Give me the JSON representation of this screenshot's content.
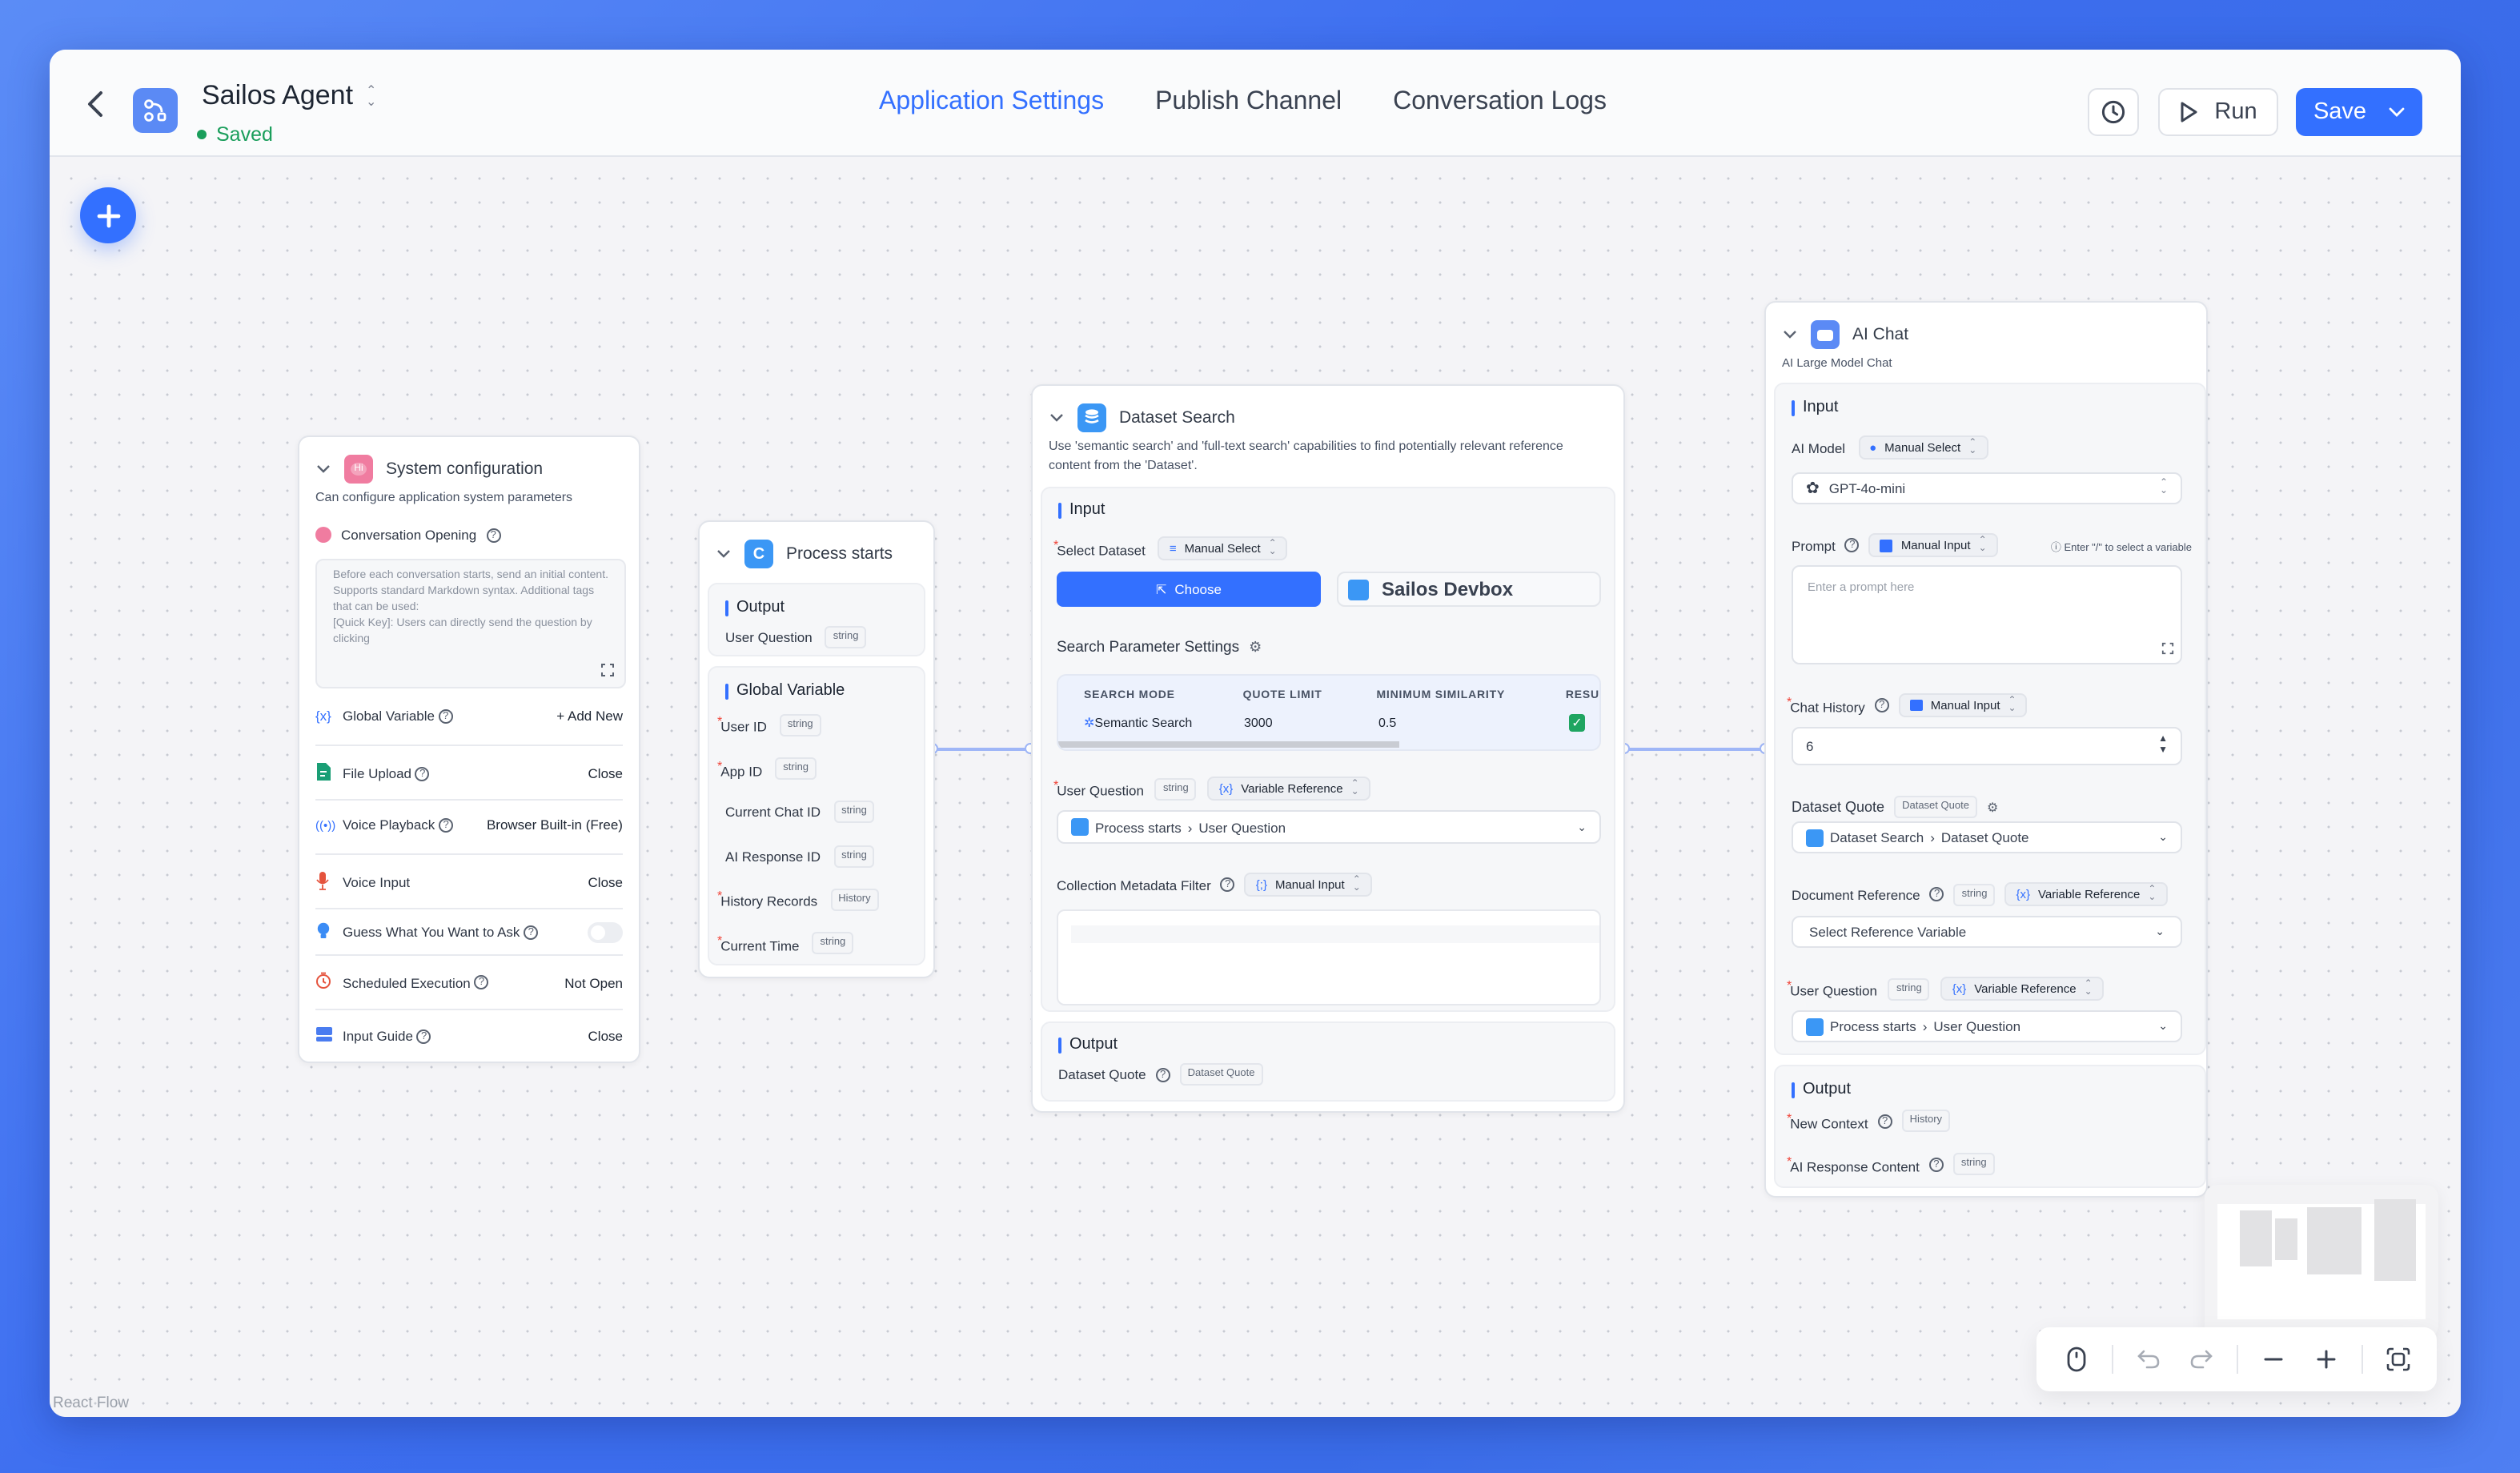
{
  "header": {
    "app_name": "Sailos Agent",
    "status": "Saved",
    "tabs": [
      {
        "label": "Application Settings",
        "active": true
      },
      {
        "label": "Publish Channel",
        "active": false
      },
      {
        "label": "Conversation Logs",
        "active": false
      }
    ],
    "run_label": "Run",
    "save_label": "Save",
    "accent_color": "#3370ff",
    "status_color": "#1a9e5b"
  },
  "system_config": {
    "title": "System configuration",
    "description": "Can configure application system parameters",
    "opening_label": "Conversation Opening",
    "opening_placeholder": "Before each conversation starts, send an initial content. Supports standard Markdown syntax. Additional tags that can be used:\n[Quick Key]: Users can directly send the question by clicking",
    "rows": [
      {
        "label": "Global Variable",
        "value": "+ Add New",
        "icon": "variable-icon"
      },
      {
        "label": "File Upload",
        "value": "Close",
        "icon": "file-icon"
      },
      {
        "label": "Voice Playback",
        "value": "Browser Built-in (Free)",
        "icon": "broadcast-icon"
      },
      {
        "label": "Voice Input",
        "value": "Close",
        "icon": "microphone-icon"
      },
      {
        "label": "Guess What You Want to Ask",
        "value": "",
        "icon": "lightbulb-icon",
        "toggle": false
      },
      {
        "label": "Scheduled Execution",
        "value": "Not Open",
        "icon": "timer-icon"
      },
      {
        "label": "Input Guide",
        "value": "Close",
        "icon": "guide-icon"
      }
    ]
  },
  "process_start": {
    "title": "Process starts",
    "output_heading": "Output",
    "outputs": [
      {
        "label": "User Question",
        "type": "string"
      }
    ],
    "globals_heading": "Global Variable",
    "globals": [
      {
        "label": "User ID",
        "type": "string",
        "required": true
      },
      {
        "label": "App ID",
        "type": "string",
        "required": true
      },
      {
        "label": "Current Chat ID",
        "type": "string",
        "required": false
      },
      {
        "label": "AI Response ID",
        "type": "string",
        "required": false
      },
      {
        "label": "History Records",
        "type": "History",
        "required": true
      },
      {
        "label": "Current Time",
        "type": "string",
        "required": true
      }
    ]
  },
  "dataset_search": {
    "title": "Dataset Search",
    "description": "Use 'semantic search' and 'full-text search' capabilities to find potentially relevant reference content from the 'Dataset'.",
    "input_heading": "Input",
    "select_dataset_label": "Select Dataset",
    "select_dataset_mode": "Manual Select",
    "choose_label": "Choose",
    "selected_dataset": "Sailos Devbox",
    "search_params_label": "Search Parameter Settings",
    "params_table": {
      "headers": [
        "SEARCH MODE",
        "QUOTE LIMIT",
        "MINIMUM SIMILARITY",
        "RESU"
      ],
      "row": [
        "Semantic Search",
        "3000",
        "0.5",
        "checked"
      ]
    },
    "user_question_label": "User Question",
    "user_question_type": "string",
    "user_question_mode": "Variable Reference",
    "user_question_value_node": "Process starts",
    "user_question_value_field": "User Question",
    "metadata_label": "Collection Metadata Filter",
    "metadata_mode": "Manual Input",
    "output_heading": "Output",
    "output_label": "Dataset Quote",
    "output_type": "Dataset Quote"
  },
  "ai_chat": {
    "title": "AI Chat",
    "description": "AI Large Model Chat",
    "input_heading": "Input",
    "model_label": "AI Model",
    "model_mode": "Manual Select",
    "model_value": "GPT-4o-mini",
    "prompt_label": "Prompt",
    "prompt_mode": "Manual Input",
    "prompt_hint": "Enter \"/\" to select a variable",
    "prompt_placeholder": "Enter a prompt here",
    "history_label": "Chat History",
    "history_mode": "Manual Input",
    "history_value": "6",
    "quote_label": "Dataset Quote",
    "quote_type": "Dataset Quote",
    "quote_value_node": "Dataset Search",
    "quote_value_field": "Dataset Quote",
    "docref_label": "Document Reference",
    "docref_type": "string",
    "docref_mode": "Variable Reference",
    "docref_placeholder": "Select Reference Variable",
    "uq_label": "User Question",
    "uq_type": "string",
    "uq_mode": "Variable Reference",
    "uq_value_node": "Process starts",
    "uq_value_field": "User Question",
    "output_heading": "Output",
    "outputs": [
      {
        "label": "New Context",
        "type": "History"
      },
      {
        "label": "AI Response Content",
        "type": "string"
      }
    ]
  },
  "footer": {
    "attribution": "React Flow"
  }
}
